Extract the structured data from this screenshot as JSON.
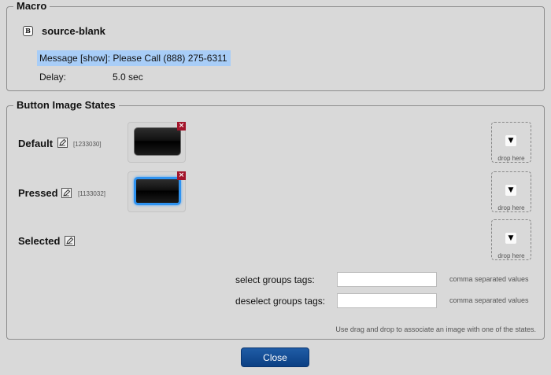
{
  "macro": {
    "legend": "Macro",
    "badge": "B",
    "name": "source-blank",
    "message": "Message [show]: Please Call (888) 275-6311",
    "delay_label": "Delay:",
    "delay_value": "5.0 sec"
  },
  "states": {
    "legend": "Button Image States",
    "items": [
      {
        "label": "Default",
        "image_id": "[1233030]",
        "remove_icon": "×",
        "drop_icon": "▼",
        "drop_label": "drop here"
      },
      {
        "label": "Pressed",
        "image_id": "[1133032]",
        "remove_icon": "×",
        "drop_icon": "▼",
        "drop_label": "drop here"
      },
      {
        "label": "Selected",
        "image_id": "",
        "drop_icon": "▼",
        "drop_label": "drop here"
      }
    ],
    "select_tags_label": "select groups tags:",
    "select_tags_value": "",
    "deselect_tags_label": "deselect groups tags:",
    "deselect_tags_value": "",
    "tags_hint": "comma separated values",
    "footer_hint": "Use drag and drop to associate an image with one of the states."
  },
  "close_label": "Close",
  "colors": {
    "highlight": "#a8cdf7",
    "remove": "#a3152b",
    "pressed_border": "#2f93f0",
    "close_button": "#0b3f83"
  },
  "icons": {
    "edit": "pencil-edit-icon",
    "remove": "remove-icon",
    "drop": "arrow-down-icon"
  }
}
